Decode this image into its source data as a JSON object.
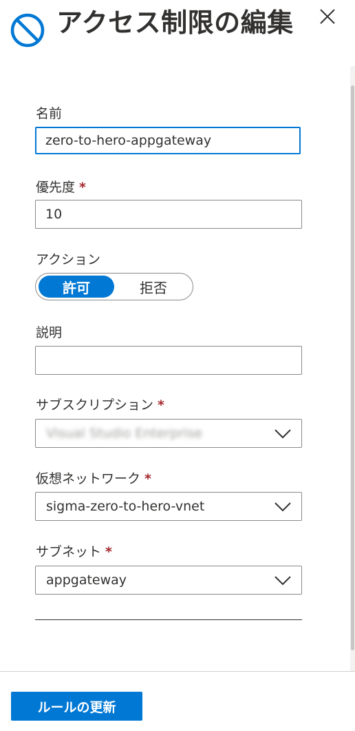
{
  "header": {
    "icon": "blocked-circle-icon",
    "title": "アクセス制限の編集",
    "close_icon": "close-icon"
  },
  "form": {
    "name": {
      "label": "名前",
      "value": "zero-to-hero-appgateway"
    },
    "priority": {
      "label": "優先度",
      "required": "*",
      "value": "10"
    },
    "action": {
      "label": "アクション",
      "options": [
        "許可",
        "拒否"
      ],
      "selected": "許可"
    },
    "description": {
      "label": "説明",
      "value": ""
    },
    "subscription": {
      "label": "サブスクリプション",
      "required": "*",
      "value": "Visual Studio Enterprise",
      "value_obscured": true
    },
    "vnet": {
      "label": "仮想ネットワーク",
      "required": "*",
      "value": "sigma-zero-to-hero-vnet"
    },
    "subnet": {
      "label": "サブネット",
      "required": "*",
      "value": "appgateway"
    }
  },
  "footer": {
    "update_button_label": "ルールの更新"
  },
  "colors": {
    "accent": "#0078d4",
    "required": "#a4262c",
    "text": "#323130",
    "border": "#8a8886"
  }
}
